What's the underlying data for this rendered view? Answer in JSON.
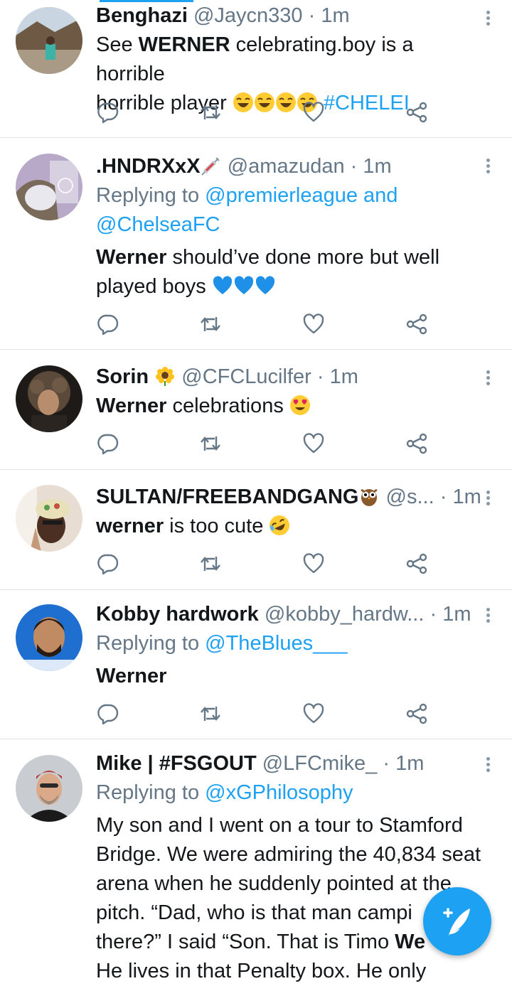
{
  "tweets": [
    {
      "name": "Benghazi",
      "handle": "@Jaycn330",
      "sep": "·",
      "time": "1m",
      "body_parts": [
        "See ",
        "WERNER",
        " celebrating.boy is a horrible",
        "horrible player",
        "#CHELEI"
      ]
    },
    {
      "name": ".HNDRXxX",
      "handle": "@amazudan",
      "sep": "·",
      "time": "1m",
      "reply_prefix": "Replying to",
      "reply_mention1": "@premierleague",
      "reply_and": "and",
      "reply_mention2": "@ChelseaFC",
      "body_parts": [
        "Werner",
        " should’ve done more but well",
        "played boys"
      ]
    },
    {
      "name": "Sorin",
      "handle": "@CFCLucilfer",
      "sep": "·",
      "time": "1m",
      "body_parts": [
        "Werner",
        " celebrations"
      ]
    },
    {
      "name": "SULTAN/FREEBANDGANG",
      "handle": "@s...",
      "sep": "·",
      "time": "1m",
      "body_parts": [
        "werner",
        " is too cute"
      ]
    },
    {
      "name": "Kobby hardwork",
      "handle": "@kobby_hardw...",
      "sep": "·",
      "time": "1m",
      "reply_prefix": "Replying to",
      "reply_mention1": "@TheBlues___",
      "body_parts": [
        "Werner"
      ]
    },
    {
      "name": "Mike | #FSGOUT",
      "handle": "@LFCmike_",
      "sep": "·",
      "time": "1m",
      "reply_prefix": "Replying to",
      "reply_mention1": "@xGPhilosophy",
      "body_lines": [
        "My son and I went on a tour to Stamford",
        "Bridge. We were admiring the 40,834 seat",
        "arena when he suddenly pointed at the",
        "pitch. “Dad, who is that man campi",
        "there?” I said “Son. That is Timo ",
        "We",
        "He lives in that Penalty box. He only"
      ]
    }
  ],
  "icons": {
    "reply": "reply-icon",
    "retweet": "retweet-icon",
    "like": "heart-icon",
    "share": "share-icon",
    "compose": "compose-tweet-icon"
  },
  "colors": {
    "accent": "#1da1f2",
    "muted": "#657786"
  }
}
